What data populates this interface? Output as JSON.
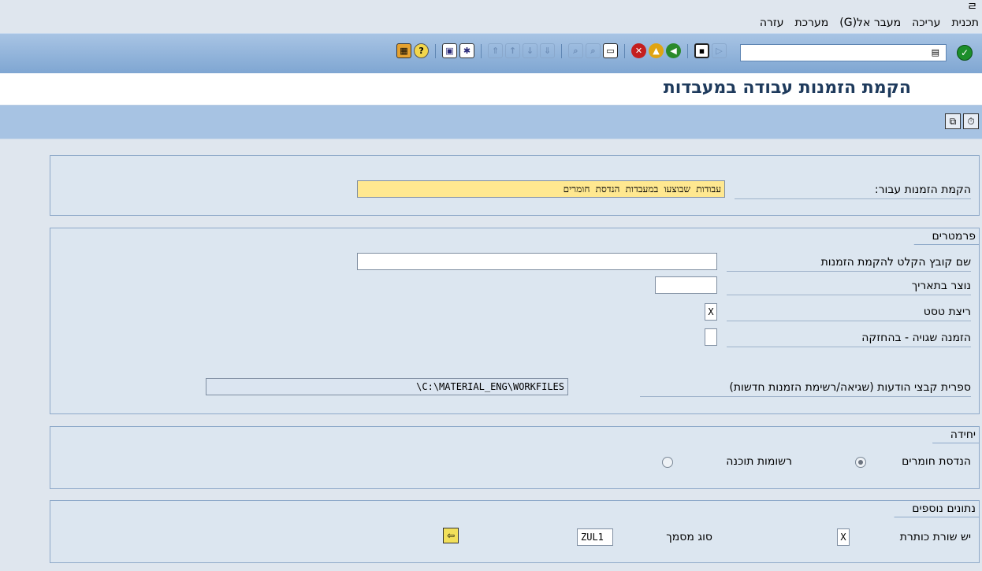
{
  "menubar": {
    "glyph": "ㄹ",
    "items": [
      "תכנית",
      "עריכה",
      "מעבר אל(G)",
      "מערכת",
      "עזרה"
    ]
  },
  "toolbar": {
    "ok_icon": "green-check-icon",
    "command_value": "",
    "colors": {
      "bar": "#8fb1d9",
      "title": "#1e3a5c"
    }
  },
  "title": "הקמת הזמנות עבודה במעבדות",
  "header_panel": {
    "label": "הקמת הזמנות עבור:",
    "value": "עבודות שבוצעו במעבדות הנדסת חומרים"
  },
  "params": {
    "title": "פרמטרים",
    "file_label": "שם קובץ הקלט להקמת הזמנות",
    "file_value": "",
    "date_label": "נוצר בתאריך",
    "date_value": "",
    "test_label": "ריצת טסט",
    "test_value": "X",
    "error_label": "הזמנה שגויה - בהחזקה",
    "error_value": "",
    "dir_label": "ספרית קבצי הודעות (שגיאה/רשימת הזמנות חדשות)",
    "dir_value": "\\C:\\MATERIAL_ENG\\WORKFILES"
  },
  "unit": {
    "title": "יחידה",
    "opt1": "הנדסת חומרים",
    "opt2": "רשומות תוכנה",
    "selected": "הנדסת חומרים"
  },
  "extra": {
    "title": "נתונים נוספים",
    "header_label": "יש שורת כותרת",
    "header_value": "X",
    "doctype_label": "סוג מסמך",
    "doctype_value": "ZUL1"
  }
}
